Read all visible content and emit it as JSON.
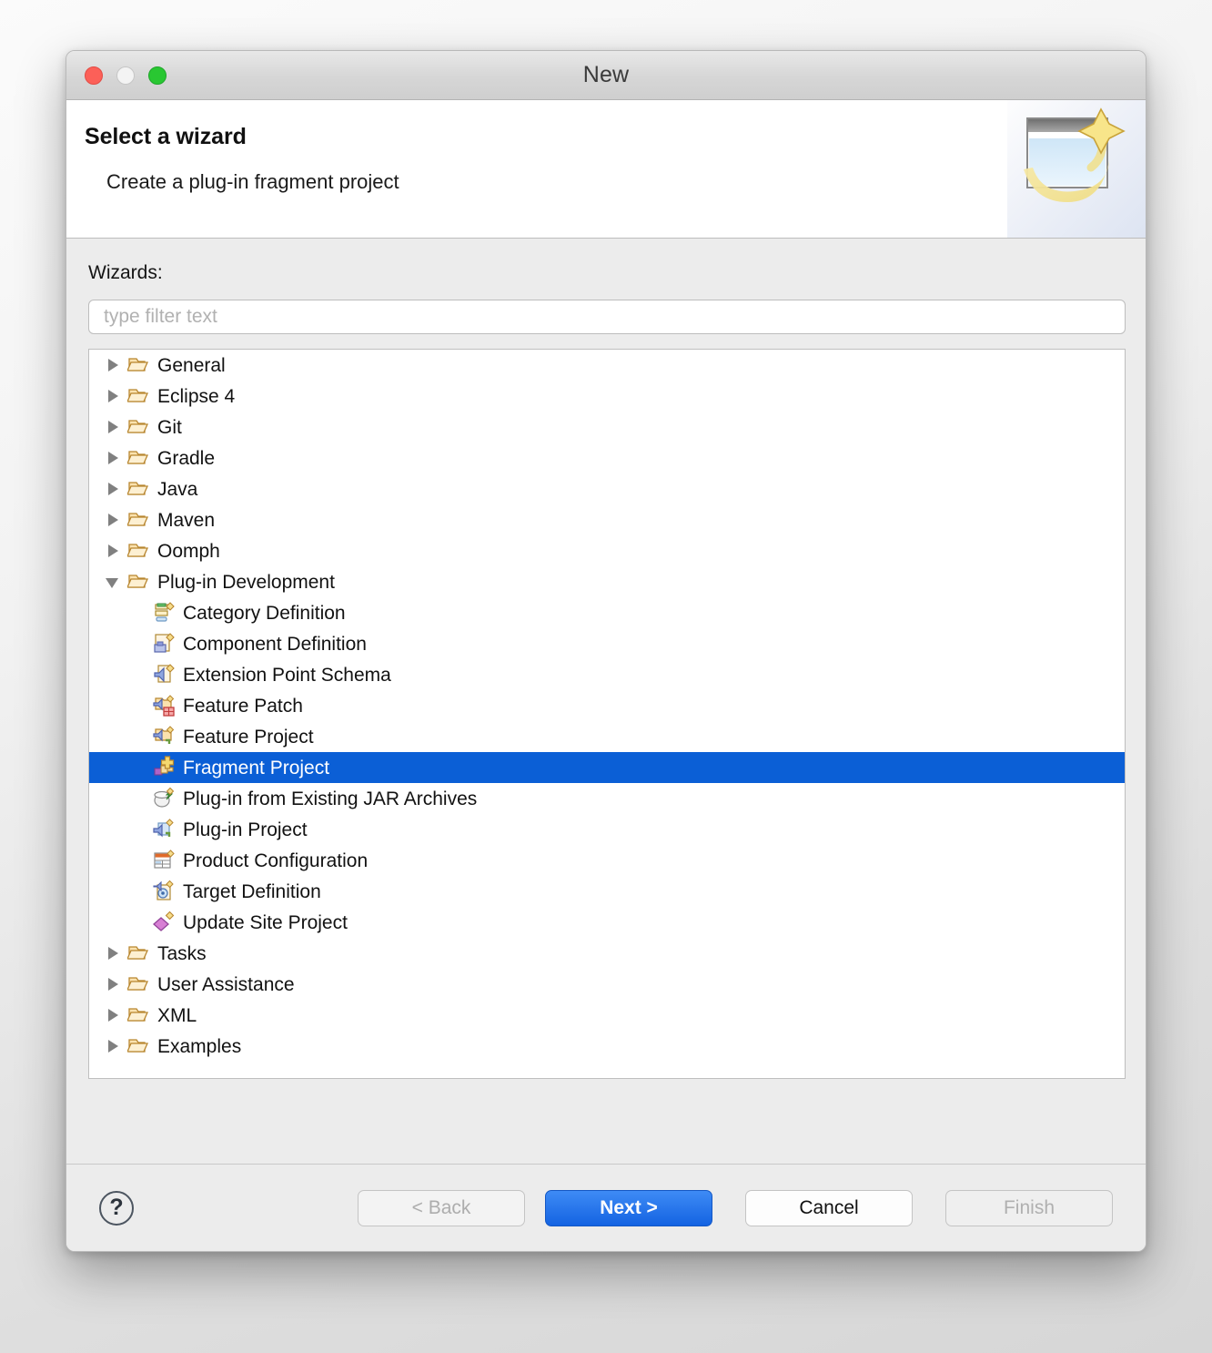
{
  "window": {
    "title": "New",
    "traffic_lights": [
      "close-button",
      "minimize-button",
      "maximize-button"
    ]
  },
  "header": {
    "title": "Select a wizard",
    "subtitle": "Create a plug-in fragment project",
    "banner_icon": "wizard-window-sparkle-icon"
  },
  "body": {
    "wizards_label": "Wizards:",
    "filter": {
      "value": "",
      "placeholder": "type filter text"
    }
  },
  "tree": {
    "selected": "Fragment Project",
    "selection_color": "#0b5fd6",
    "items": [
      {
        "label": "General",
        "level": 0,
        "icon": "folder-icon",
        "expanded": false
      },
      {
        "label": "Eclipse 4",
        "level": 0,
        "icon": "folder-icon",
        "expanded": false
      },
      {
        "label": "Git",
        "level": 0,
        "icon": "folder-icon",
        "expanded": false
      },
      {
        "label": "Gradle",
        "level": 0,
        "icon": "folder-icon",
        "expanded": false
      },
      {
        "label": "Java",
        "level": 0,
        "icon": "folder-icon",
        "expanded": false
      },
      {
        "label": "Maven",
        "level": 0,
        "icon": "folder-icon",
        "expanded": false
      },
      {
        "label": "Oomph",
        "level": 0,
        "icon": "folder-icon",
        "expanded": false
      },
      {
        "label": "Plug-in Development",
        "level": 0,
        "icon": "folder-icon",
        "expanded": true
      },
      {
        "label": "Category Definition",
        "level": 1,
        "icon": "category-definition-icon"
      },
      {
        "label": "Component Definition",
        "level": 1,
        "icon": "component-definition-icon"
      },
      {
        "label": "Extension Point Schema",
        "level": 1,
        "icon": "extension-point-schema-icon"
      },
      {
        "label": "Feature Patch",
        "level": 1,
        "icon": "feature-patch-icon"
      },
      {
        "label": "Feature Project",
        "level": 1,
        "icon": "feature-project-icon"
      },
      {
        "label": "Fragment Project",
        "level": 1,
        "icon": "fragment-project-icon",
        "selected": true
      },
      {
        "label": "Plug-in from Existing JAR Archives",
        "level": 1,
        "icon": "plugin-from-jar-icon"
      },
      {
        "label": "Plug-in Project",
        "level": 1,
        "icon": "plugin-project-icon"
      },
      {
        "label": "Product Configuration",
        "level": 1,
        "icon": "product-configuration-icon"
      },
      {
        "label": "Target Definition",
        "level": 1,
        "icon": "target-definition-icon"
      },
      {
        "label": "Update Site Project",
        "level": 1,
        "icon": "update-site-project-icon"
      },
      {
        "label": "Tasks",
        "level": 0,
        "icon": "folder-icon",
        "expanded": false
      },
      {
        "label": "User Assistance",
        "level": 0,
        "icon": "folder-icon",
        "expanded": false
      },
      {
        "label": "XML",
        "level": 0,
        "icon": "folder-icon",
        "expanded": false
      },
      {
        "label": "Examples",
        "level": 0,
        "icon": "folder-icon",
        "expanded": false
      }
    ]
  },
  "footer": {
    "help_label": "?",
    "back_label": "< Back",
    "next_label": "Next >",
    "cancel_label": "Cancel",
    "finish_label": "Finish",
    "back_enabled": false,
    "next_enabled": true,
    "cancel_enabled": true,
    "finish_enabled": false,
    "next_accent_color": "#1463e2"
  }
}
